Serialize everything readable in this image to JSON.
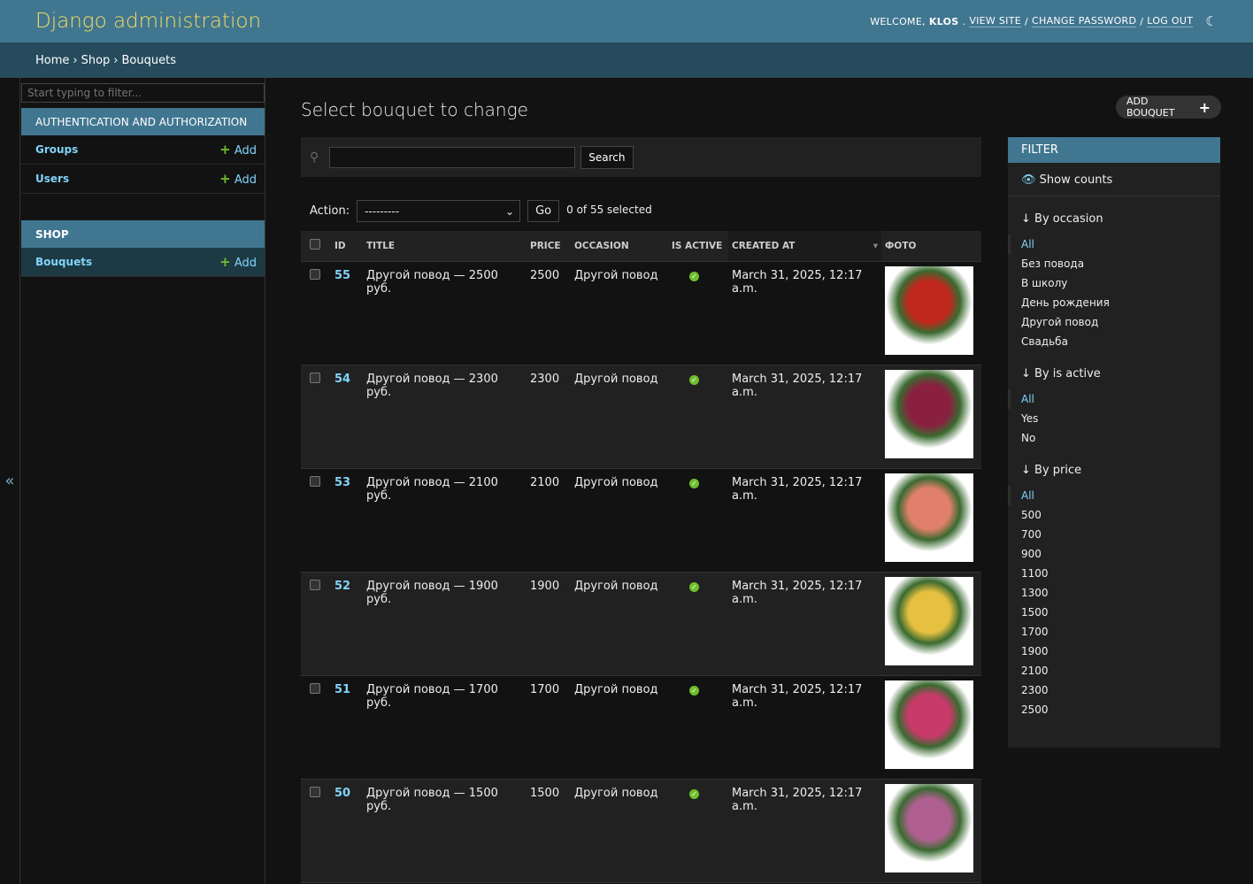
{
  "header": {
    "title": "Django administration",
    "welcome": "WELCOME,",
    "user": "KLOS",
    "view_site": "VIEW SITE",
    "change_password": "CHANGE PASSWORD",
    "log_out": "LOG OUT"
  },
  "breadcrumbs": [
    "Home",
    "Shop",
    "Bouquets"
  ],
  "sidebar": {
    "filter_placeholder": "Start typing to filter...",
    "toggle": "«",
    "apps": [
      {
        "name": "AUTHENTICATION AND AUTHORIZATION",
        "models": [
          {
            "name": "Groups",
            "add": "Add"
          },
          {
            "name": "Users",
            "add": "Add"
          }
        ]
      },
      {
        "name": "SHOP",
        "models": [
          {
            "name": "Bouquets",
            "add": "Add"
          }
        ]
      }
    ]
  },
  "main": {
    "title": "Select bouquet to change",
    "add_button": "ADD BOUQUET",
    "search_button": "Search",
    "action_label": "Action:",
    "action_value": "---------",
    "go": "Go",
    "selected": "0 of 55 selected",
    "columns": [
      "ID",
      "TITLE",
      "PRICE",
      "OCCASION",
      "IS ACTIVE",
      "CREATED AT",
      "ФОТО"
    ],
    "rows": [
      {
        "id": "55",
        "title": "Другой повод — 2500 руб.",
        "price": "2500",
        "occasion": "Другой повод",
        "active": true,
        "created": "March 31, 2025, 12:17 a.m.",
        "photo_color": "#c0281e"
      },
      {
        "id": "54",
        "title": "Другой повод — 2300 руб.",
        "price": "2300",
        "occasion": "Другой повод",
        "active": true,
        "created": "March 31, 2025, 12:17 a.m.",
        "photo_color": "#8a2040"
      },
      {
        "id": "53",
        "title": "Другой повод — 2100 руб.",
        "price": "2100",
        "occasion": "Другой повод",
        "active": true,
        "created": "March 31, 2025, 12:17 a.m.",
        "photo_color": "#e0806a"
      },
      {
        "id": "52",
        "title": "Другой повод — 1900 руб.",
        "price": "1900",
        "occasion": "Другой повод",
        "active": true,
        "created": "March 31, 2025, 12:17 a.m.",
        "photo_color": "#e6c040"
      },
      {
        "id": "51",
        "title": "Другой повод — 1700 руб.",
        "price": "1700",
        "occasion": "Другой повод",
        "active": true,
        "created": "March 31, 2025, 12:17 a.m.",
        "photo_color": "#c83a6a"
      },
      {
        "id": "50",
        "title": "Другой повод — 1500 руб.",
        "price": "1500",
        "occasion": "Другой повод",
        "active": true,
        "created": "March 31, 2025, 12:17 a.m.",
        "photo_color": "#b06090"
      }
    ]
  },
  "filter": {
    "title": "FILTER",
    "show_counts": "Show counts",
    "sections": [
      {
        "title": "↓ By occasion",
        "items": [
          "All",
          "Без повода",
          "В школу",
          "День рождения",
          "Другой повод",
          "Свадьба"
        ]
      },
      {
        "title": "↓ By is active",
        "items": [
          "All",
          "Yes",
          "No"
        ]
      },
      {
        "title": "↓ By price",
        "items": [
          "All",
          "500",
          "700",
          "900",
          "1100",
          "1300",
          "1500",
          "1700",
          "1900",
          "2100",
          "2300",
          "2500"
        ]
      }
    ]
  }
}
